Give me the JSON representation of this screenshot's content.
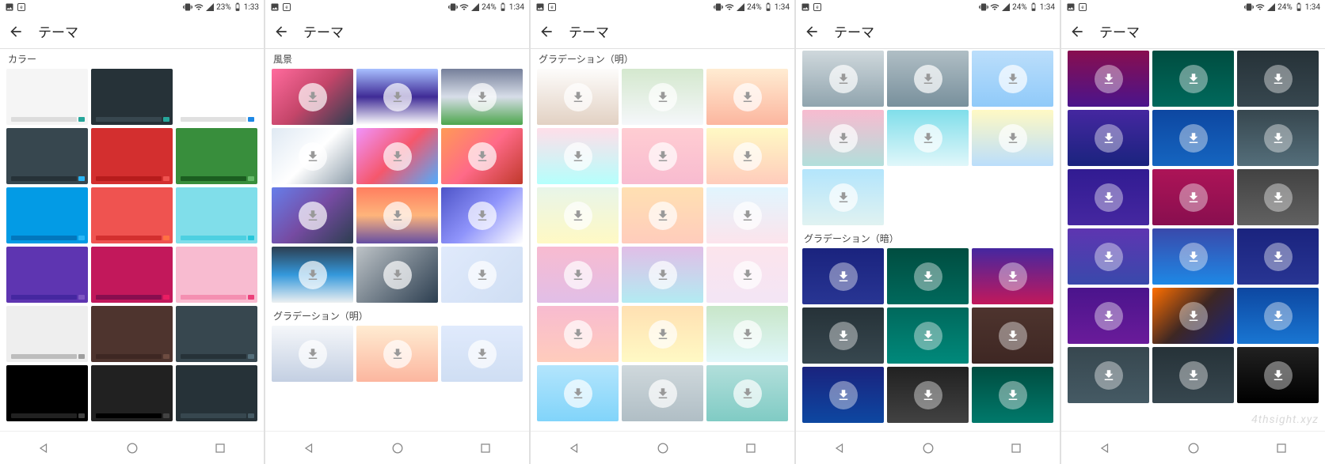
{
  "screens": [
    {
      "status": {
        "battery": "23%",
        "time": "1:33"
      },
      "title": "テーマ",
      "sections": [
        {
          "label": "カラー",
          "download_overlay": false,
          "tiles": [
            {
              "bg": "#f5f5f5",
              "bar": "#dcdcdc",
              "accent": "#26a69a"
            },
            {
              "bg": "#263238",
              "bar": "#37474f",
              "accent": "#26a69a"
            },
            {
              "bg": "#ffffff",
              "bar": "#e0e0e0",
              "accent": "#1e88e5"
            },
            {
              "bg": "#37474f",
              "bar": "#263238",
              "accent": "#29b6f6"
            },
            {
              "bg": "#d32f2f",
              "bar": "#b71c1c",
              "accent": "#ef5350"
            },
            {
              "bg": "#388e3c",
              "bar": "#1b5e20",
              "accent": "#66bb6a"
            },
            {
              "bg": "#039be5",
              "bar": "#0277bd",
              "accent": "#29b6f6"
            },
            {
              "bg": "#ef5350",
              "bar": "#d32f2f",
              "accent": "#ff7043"
            },
            {
              "bg": "#80deea",
              "bar": "#4dd0e1",
              "accent": "#26c6da"
            },
            {
              "bg": "#5e35b1",
              "bar": "#4527a0",
              "accent": "#7e57c2"
            },
            {
              "bg": "#c2185b",
              "bar": "#880e4f",
              "accent": "#e91e63"
            },
            {
              "bg": "#f8bbd0",
              "bar": "#f48fb1",
              "accent": "#ec407a"
            },
            {
              "bg": "#eeeeee",
              "bar": "#bdbdbd",
              "accent": "#9e9e9e"
            },
            {
              "bg": "#4e342e",
              "bar": "#3e2723",
              "accent": "#6d4c41"
            },
            {
              "bg": "#37474f",
              "bar": "#263238",
              "accent": "#546e7a"
            },
            {
              "bg": "#000000",
              "bar": "#212121",
              "accent": "#424242"
            },
            {
              "bg": "#212121",
              "bar": "#000000",
              "accent": "#424242"
            },
            {
              "bg": "#263238",
              "bar": "#37474f",
              "accent": "#455a64"
            }
          ]
        }
      ]
    },
    {
      "status": {
        "battery": "24%",
        "time": "1:34"
      },
      "title": "テーマ",
      "sections": [
        {
          "label": "風景",
          "download_overlay": true,
          "tiles": [
            {
              "bg": "linear-gradient(135deg,#ff6b9d,#c44569,#2c3e50)"
            },
            {
              "bg": "linear-gradient(180deg,#a8c0ff,#3f2b96,#ffffff)"
            },
            {
              "bg": "linear-gradient(180deg,#757f9a,#d7dde8,#4ca64c)"
            },
            {
              "bg": "linear-gradient(135deg,#dfe9f3,#ffffff,#8e9eab)"
            },
            {
              "bg": "linear-gradient(135deg,#f093fb,#f5576c,#4facfe)"
            },
            {
              "bg": "linear-gradient(135deg,#ff9a56,#ff6a88,#c0392b)"
            },
            {
              "bg": "linear-gradient(135deg,#667eea,#764ba2,#2c3e50)"
            },
            {
              "bg": "linear-gradient(180deg,#ff7e5f,#feb47b,#654ea3)"
            },
            {
              "bg": "linear-gradient(135deg,#4e54c8,#8f94fb,#ffffff)"
            },
            {
              "bg": "linear-gradient(180deg,#2c3e50,#3498db,#ecf0f1)"
            },
            {
              "bg": "linear-gradient(135deg,#bdc3c7,#2c3e50)"
            },
            {
              "bg": "linear-gradient(135deg,#e0eafc,#cfdef3)"
            }
          ]
        },
        {
          "label": "グラデーション（明）",
          "download_overlay": true,
          "tiles": [
            {
              "bg": "linear-gradient(180deg,#f5f7fa,#c3cfe2)"
            },
            {
              "bg": "linear-gradient(180deg,#ffecd2,#fcb69f)"
            },
            {
              "bg": "linear-gradient(180deg,#e0eafc,#cfdef3)"
            }
          ]
        }
      ]
    },
    {
      "status": {
        "battery": "24%",
        "time": "1:34"
      },
      "title": "テーマ",
      "sections": [
        {
          "label": "グラデーション（明）",
          "download_overlay": true,
          "tiles": [
            {
              "bg": "linear-gradient(180deg,#fdfcfb,#e2d1c3)"
            },
            {
              "bg": "linear-gradient(180deg,#d4e8ce,#f5f7fa)"
            },
            {
              "bg": "linear-gradient(180deg,#ffecd2,#fcb69f)"
            },
            {
              "bg": "linear-gradient(180deg,#ffdee9,#b5fffc)"
            },
            {
              "bg": "linear-gradient(180deg,#ffcdd2,#f8bbd0)"
            },
            {
              "bg": "linear-gradient(180deg,#fff9c4,#ffccbc)"
            },
            {
              "bg": "linear-gradient(180deg,#e8f5e9,#fff9c4)"
            },
            {
              "bg": "linear-gradient(180deg,#ffe0b2,#ffccbc)"
            },
            {
              "bg": "linear-gradient(180deg,#e1f5fe,#fce4ec)"
            },
            {
              "bg": "linear-gradient(180deg,#f8bbd0,#e1bee7)"
            },
            {
              "bg": "linear-gradient(180deg,#e1bee7,#b2ebf2)"
            },
            {
              "bg": "linear-gradient(180deg,#fce4ec,#f3e5f5)"
            },
            {
              "bg": "linear-gradient(180deg,#f8bbd0,#ffccbc)"
            },
            {
              "bg": "linear-gradient(180deg,#ffe0b2,#fff9c4)"
            },
            {
              "bg": "linear-gradient(180deg,#c8e6c9,#e0f7fa)"
            },
            {
              "bg": "linear-gradient(180deg,#b3e5fc,#81d4fa)"
            },
            {
              "bg": "linear-gradient(180deg,#cfd8dc,#b0bec5)"
            },
            {
              "bg": "linear-gradient(180deg,#b2dfdb,#80cbc4)"
            }
          ]
        }
      ]
    },
    {
      "status": {
        "battery": "24%",
        "time": "1:34"
      },
      "title": "テーマ",
      "sections": [
        {
          "label": "",
          "download_overlay": true,
          "tiles": [
            {
              "bg": "linear-gradient(180deg,#cfd8dc,#90a4ae)"
            },
            {
              "bg": "linear-gradient(180deg,#b0bec5,#78909c)"
            },
            {
              "bg": "linear-gradient(180deg,#bbdefb,#90caf9)"
            },
            {
              "bg": "linear-gradient(180deg,#f8bbd0,#b2dfdb)"
            },
            {
              "bg": "linear-gradient(180deg,#80deea,#e0f7fa)"
            },
            {
              "bg": "linear-gradient(180deg,#fff9c4,#bbdefb)"
            },
            {
              "bg": "linear-gradient(180deg,#b3e5fc,#e0f2f1)"
            }
          ]
        },
        {
          "label": "グラデーション（暗）",
          "download_overlay": true,
          "overlay_class": "dark",
          "tiles": [
            {
              "bg": "linear-gradient(180deg,#1a237e,#283593)"
            },
            {
              "bg": "linear-gradient(180deg,#004d40,#00695c)"
            },
            {
              "bg": "linear-gradient(180deg,#4527a0,#c2185b)"
            },
            {
              "bg": "linear-gradient(180deg,#263238,#37474f)"
            },
            {
              "bg": "linear-gradient(180deg,#00695c,#00897b)"
            },
            {
              "bg": "linear-gradient(180deg,#4e342e,#3e2723)"
            },
            {
              "bg": "linear-gradient(180deg,#1a237e,#0d47a1)"
            },
            {
              "bg": "linear-gradient(180deg,#212121,#424242)"
            },
            {
              "bg": "linear-gradient(180deg,#004d40,#00796b)"
            }
          ]
        }
      ]
    },
    {
      "status": {
        "battery": "24%",
        "time": "1:34"
      },
      "title": "テーマ",
      "watermark": "4thsight.xyz",
      "sections": [
        {
          "label": "",
          "download_overlay": true,
          "overlay_class": "dark",
          "tiles": [
            {
              "bg": "linear-gradient(180deg,#880e4f,#4a148c)"
            },
            {
              "bg": "linear-gradient(180deg,#004d40,#00695c)"
            },
            {
              "bg": "linear-gradient(180deg,#263238,#37474f)"
            },
            {
              "bg": "linear-gradient(180deg,#4527a0,#1a237e)"
            },
            {
              "bg": "linear-gradient(180deg,#0d47a1,#1565c0)"
            },
            {
              "bg": "linear-gradient(180deg,#37474f,#546e7a)"
            },
            {
              "bg": "linear-gradient(180deg,#311b92,#4527a0)"
            },
            {
              "bg": "linear-gradient(180deg,#ad1457,#880e4f)"
            },
            {
              "bg": "linear-gradient(180deg,#424242,#616161)"
            },
            {
              "bg": "linear-gradient(180deg,#5e35b1,#3949ab)"
            },
            {
              "bg": "linear-gradient(180deg,#3949ab,#1e88e5)"
            },
            {
              "bg": "linear-gradient(180deg,#1a237e,#283593)"
            },
            {
              "bg": "linear-gradient(180deg,#4a148c,#6a1b9a)"
            },
            {
              "bg": "linear-gradient(135deg,#ff6f00,#3e2723,#1a237e)"
            },
            {
              "bg": "linear-gradient(180deg,#0d47a1,#1976d2)"
            },
            {
              "bg": "linear-gradient(180deg,#37474f,#455a64)"
            },
            {
              "bg": "linear-gradient(180deg,#263238,#37474f)"
            },
            {
              "bg": "linear-gradient(180deg,#212121,#000000)"
            }
          ]
        }
      ]
    }
  ],
  "icons": {
    "back_label": "Back",
    "nav_back": "Back",
    "nav_home": "Home",
    "nav_recent": "Recent"
  }
}
